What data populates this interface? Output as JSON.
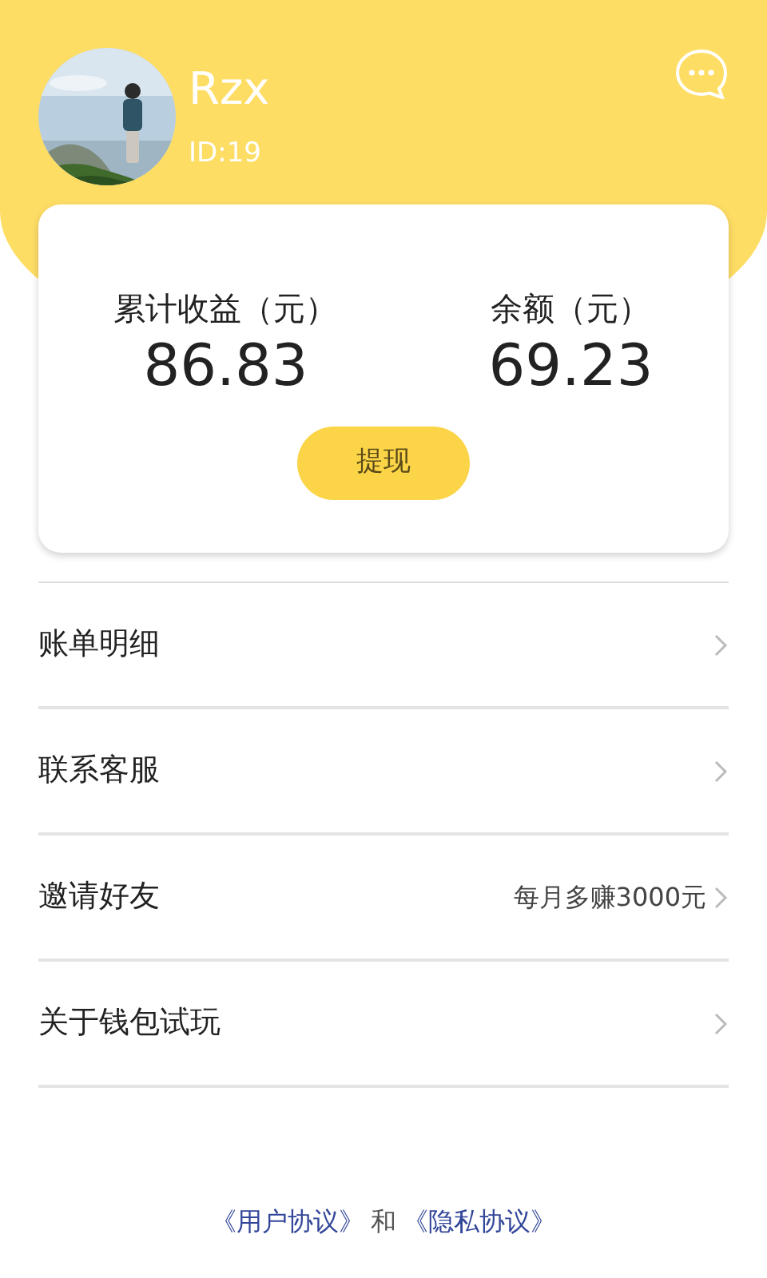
{
  "profile": {
    "name": "Rzx",
    "id": "ID:19"
  },
  "stats": [
    {
      "label": "累计收益（元）",
      "value": "86.83"
    },
    {
      "label": "余额（元）",
      "value": "69.23"
    }
  ],
  "withdraw_button": "提现",
  "menu": [
    {
      "label": "账单明细"
    },
    {
      "label": "联系客服"
    },
    {
      "label": "邀请好友",
      "note": "每月多赚3000元"
    },
    {
      "label": "关于钱包试玩"
    }
  ],
  "footer": {
    "links": [
      "《用户协议》",
      "《隐私协议》"
    ],
    "joiner": "和"
  }
}
